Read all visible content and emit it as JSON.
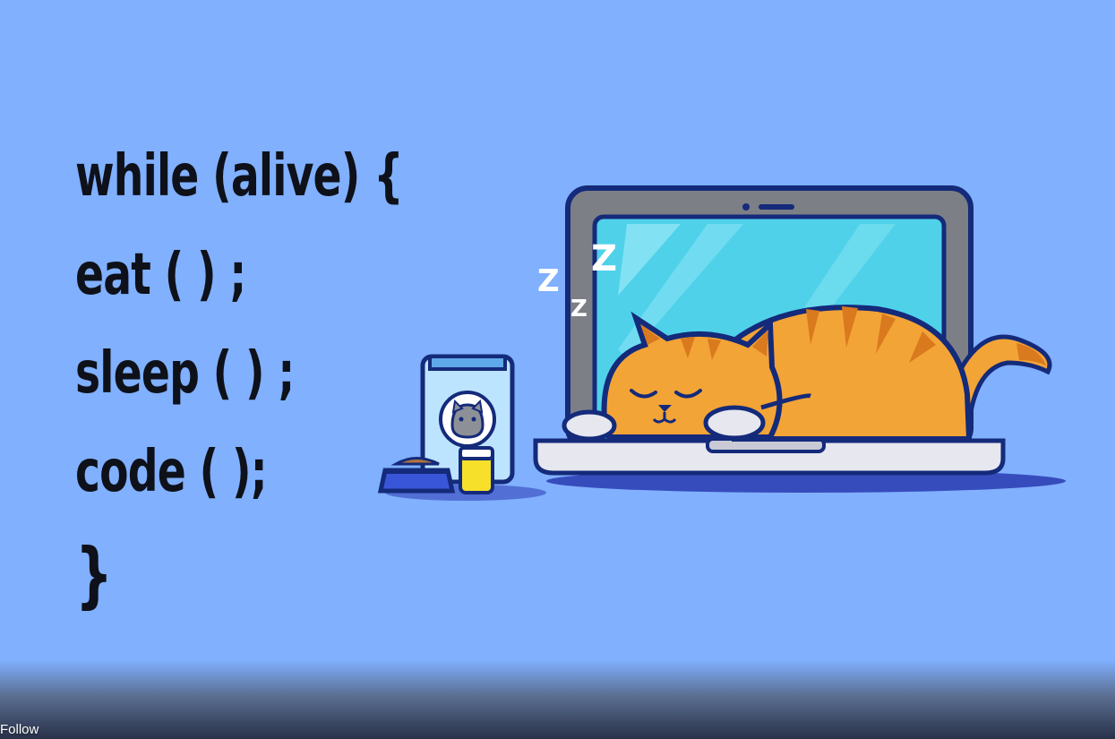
{
  "code_lines": [
    "while (alive) {",
    "eat ( ) ;",
    "sleep ( ) ;",
    "code ( );",
    "}"
  ],
  "zzz": [
    "Z",
    "Z",
    "Z"
  ],
  "bottom_bar": {
    "follow_label": "Follow"
  },
  "colors": {
    "background": "#80b0fe",
    "text": "#0e1119",
    "cat_orange": "#f3a436",
    "laptop_screen": "#4fd1ea",
    "laptop_frame": "#7d7f86",
    "outline": "#142a7a"
  }
}
